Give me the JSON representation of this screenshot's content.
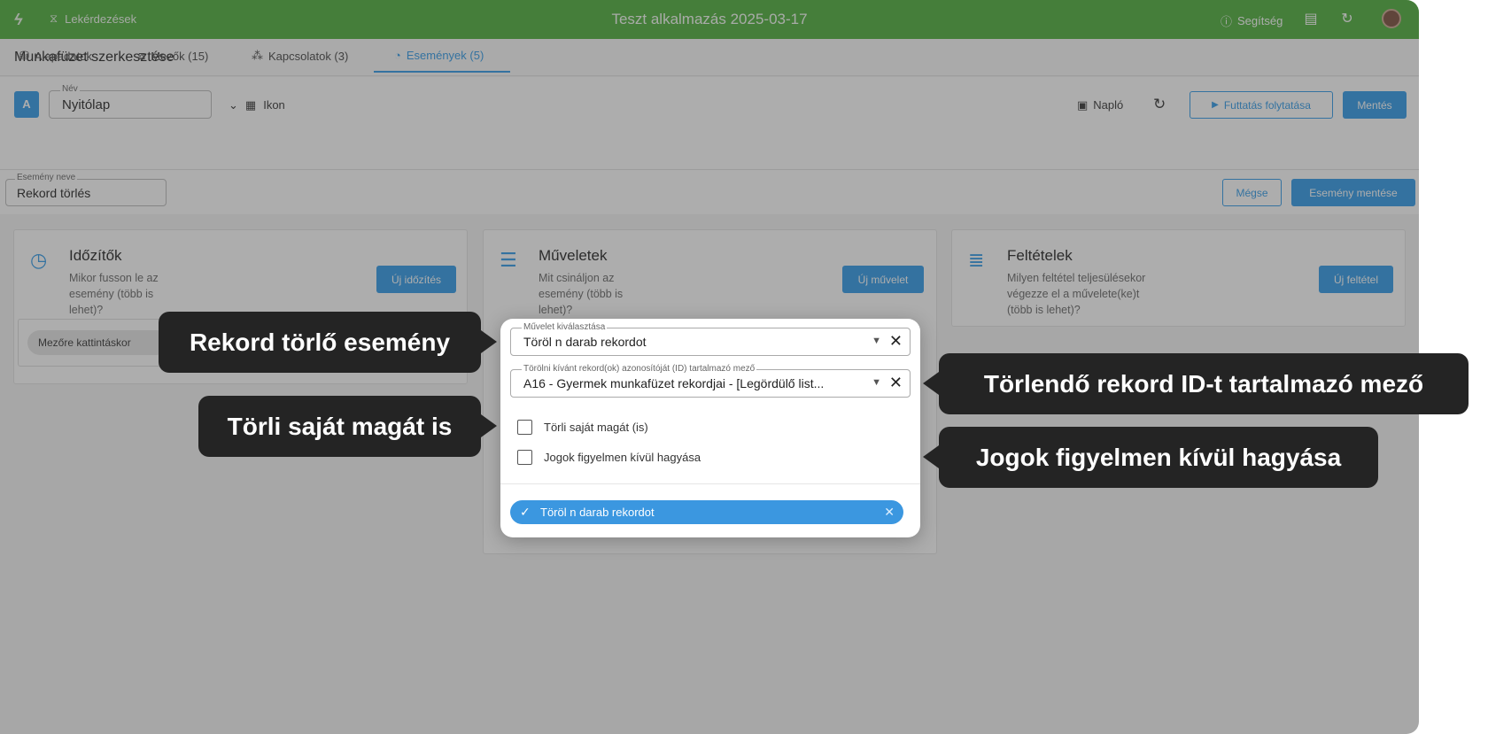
{
  "topbar": {
    "nav_label": "Lekérdezések",
    "app_title": "Teszt alkalmazás 2025-03-17",
    "help_label": "Segítség"
  },
  "page": {
    "title": "Munkafüzet szerkesztése"
  },
  "toolbar": {
    "badge": "A",
    "name_label": "Név",
    "name_value": "Nyitólap",
    "view_label": "Ikon",
    "log_label": "Napló",
    "run_label": "Futtatás folytatása",
    "save_label": "Mentés"
  },
  "tabs": [
    {
      "label": "Alapadatok"
    },
    {
      "label": "Mezők (15)"
    },
    {
      "label": "Kapcsolatok (3)"
    },
    {
      "label": "Események (5)"
    }
  ],
  "event": {
    "name_label": "Esemény neve",
    "name_value": "Rekord törlés",
    "cancel_label": "Mégse",
    "save_label": "Esemény mentése"
  },
  "cards": {
    "timers": {
      "title": "Időzítők",
      "desc": [
        "Mikor fusson le az",
        "esemény (több is",
        "lehet)?"
      ],
      "button": "Új időzítés",
      "chip": "Mezőre kattintáskor"
    },
    "actions": {
      "title": "Műveletek",
      "desc": [
        "Mit csináljon az",
        "esemény (több is",
        "lehet)?"
      ],
      "button": "Új művelet"
    },
    "conditions": {
      "title": "Feltételek",
      "desc": [
        "Milyen feltétel teljesülésekor",
        "végezze el a művelete(ke)t",
        "(több is lehet)?"
      ],
      "button": "Új feltétel"
    }
  },
  "modal": {
    "action_label": "Művelet kiválasztása",
    "action_value": "Töröl n darab rekordot",
    "id_field_label": "Törölni kívánt rekord(ok) azonosítóját (ID) tartalmazó mező",
    "id_field_value": "A16 - Gyermek munkafüzet rekordjai - [Legördülő list...",
    "checkbox_self": "Törli saját magát (is)",
    "checkbox_perm": "Jogok figyelmen kívül hagyása",
    "selected_chip": "Töröl n darab rekordot"
  },
  "callouts": {
    "delete_event": "Rekord törlő esemény",
    "id_field": "Törlendő rekord ID-t tartalmazó mező",
    "self_delete": "Törli saját magát is",
    "ignore_perms": "Jogok figyelmen kívül hagyása"
  },
  "colors": {
    "topbar": "#4caf3a",
    "accent": "#2f9ae8",
    "callout_bg": "#242424"
  }
}
